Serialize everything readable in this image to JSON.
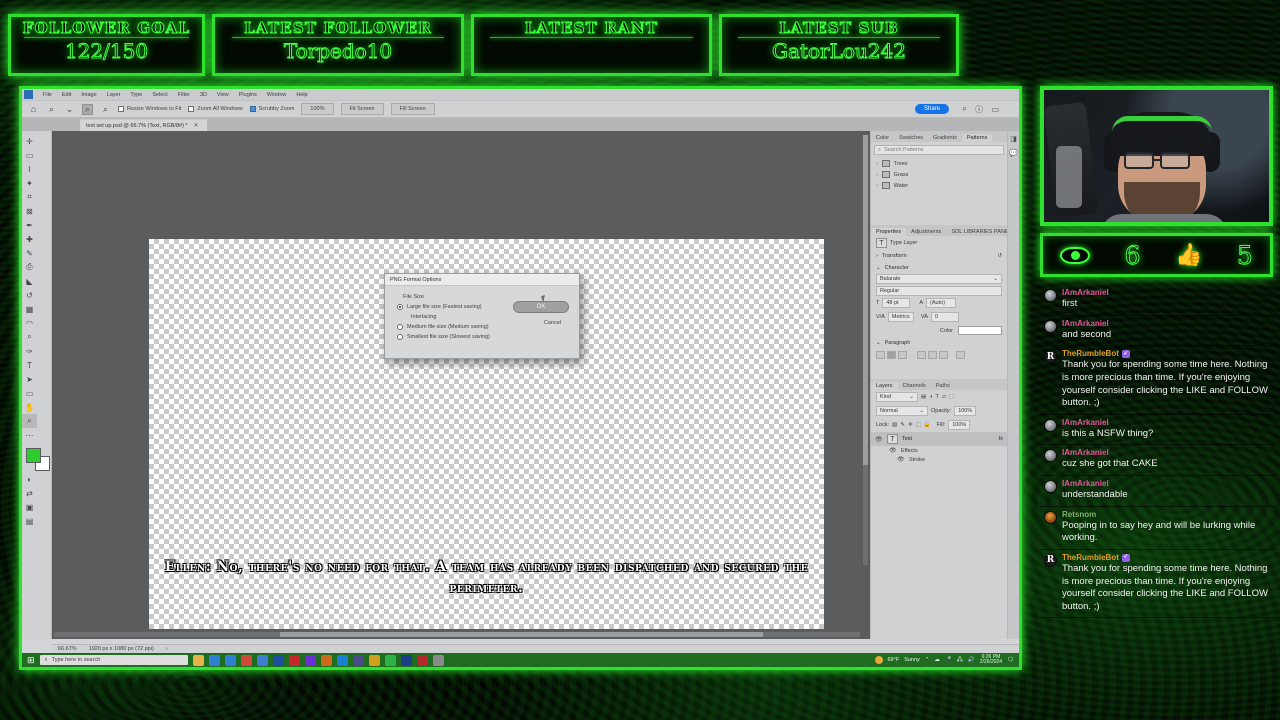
{
  "overlay": {
    "accent_green": "#2fe02f",
    "panels": [
      {
        "title": "FOLLOWER GOAL",
        "value": "122/150"
      },
      {
        "title": "LATEST FOLLOWER",
        "value": "Torpedo10"
      },
      {
        "title": "LATEST RANT",
        "value": ""
      },
      {
        "title": "LATEST SUB",
        "value": "GatorLou242"
      }
    ],
    "stats": {
      "viewers": "6",
      "likes": "5",
      "eye_icon": "eye-icon",
      "like_icon": "thumbs-up-icon"
    }
  },
  "chat": {
    "messages": [
      {
        "user": "IAmArkaniel",
        "color": "#e8559b",
        "avatar": "user",
        "badge": "",
        "text": "first"
      },
      {
        "user": "IAmArkaniel",
        "color": "#e8559b",
        "avatar": "user",
        "badge": "",
        "text": "and second"
      },
      {
        "user": "TheRumbleBot",
        "color": "#e0a02a",
        "avatar": "bot",
        "badge": "shield-badge",
        "text": "Thank you for spending some time here. Nothing is more precious than time. If you're enjoying yourself consider clicking the LIKE and FOLLOW button. ;)"
      },
      {
        "user": "IAmArkaniel",
        "color": "#e8559b",
        "avatar": "user",
        "badge": "",
        "text": "is this a NSFW thing?"
      },
      {
        "user": "IAmArkaniel",
        "color": "#e8559b",
        "avatar": "user",
        "badge": "",
        "text": "cuz she got that CAKE"
      },
      {
        "user": "IAmArkaniel",
        "color": "#e8559b",
        "avatar": "user",
        "badge": "",
        "text": "understandable"
      },
      {
        "user": "Retsnom",
        "color": "#7fb26a",
        "avatar": "rets",
        "badge": "",
        "text": "Pooping in to say hey and will be lurking while working."
      },
      {
        "user": "TheRumbleBot",
        "color": "#e0a02a",
        "avatar": "bot",
        "badge": "shield-badge",
        "text": "Thank you for spending some time here. Nothing is more precious than time. If you're enjoying yourself consider clicking the LIKE and FOLLOW button. ;)"
      }
    ]
  },
  "photoshop": {
    "menus": [
      "File",
      "Edit",
      "Image",
      "Layer",
      "Type",
      "Select",
      "Filter",
      "3D",
      "View",
      "Plugins",
      "Window",
      "Help"
    ],
    "options_bar": {
      "home_icon": "home-icon",
      "zoom_icon": "zoom-tool-icon",
      "checkboxes": [
        {
          "label": "Resize Windows to Fit",
          "checked": false
        },
        {
          "label": "Zoom All Windows",
          "checked": false
        },
        {
          "label": "Scrubby Zoom",
          "checked": true
        }
      ],
      "buttons": [
        "100%",
        "Fit Screen",
        "Fill Screen"
      ],
      "share_label": "Share"
    },
    "document_tab": "text set up.psd @ 66.7% (Text, RGB/8#) *",
    "canvas_subtitle": "Ellen: No, there's no need for that. A team has already been dispatched and secured the perimeter.",
    "dialog": {
      "title": "PNG Format Options",
      "group_label": "File Size",
      "options": [
        {
          "label": "Large file size (Fastest saving)",
          "selected": true
        },
        {
          "label": "Interlacing",
          "selected": false
        },
        {
          "label": "Medium file size (Medium saving)",
          "selected": false
        },
        {
          "label": "Smallest file size (Slowest saving)",
          "selected": false
        }
      ],
      "ok_label": "OK",
      "cancel_label": "Cancel"
    },
    "patterns_panel": {
      "tabs": [
        "Color",
        "Swatches",
        "Gradients",
        "Patterns"
      ],
      "active_tab": "Patterns",
      "search_placeholder": "Search Patterns",
      "groups": [
        "Trees",
        "Grass",
        "Water"
      ]
    },
    "properties_panel": {
      "tabs": [
        "Properties",
        "Adjustments",
        "SOL LIBRARIES PANE"
      ],
      "active_tab": "Properties",
      "layer_type": "Type Layer",
      "transform_label": "Transform",
      "character_label": "Character",
      "font_family": "Balarate",
      "font_style": "Regular",
      "font_size": "48 pt",
      "leading": "(Auto)",
      "kerning": "Metrics",
      "tracking": "0",
      "color_label": "Color",
      "paragraph_label": "Paragraph"
    },
    "layers_panel": {
      "tabs": [
        "Layers",
        "Channels",
        "Paths"
      ],
      "active_tab": "Layers",
      "filter_label": "Kind",
      "blend_mode": "Normal",
      "opacity_label": "Opacity:",
      "opacity_value": "100%",
      "lock_label": "Lock:",
      "fill_label": "Fill:",
      "fill_value": "100%",
      "layer_name": "Text",
      "effects_label": "Effects",
      "effect_stroke": "Stroke"
    },
    "status_bar": {
      "zoom": "66.67%",
      "dimensions": "1920 px x 1080 px (72 ppi)"
    },
    "taskbar": {
      "search_placeholder": "Type here to search",
      "weather_temp": "69°F",
      "weather_cond": "Sunny",
      "time": "6:26 PM",
      "date": "2/26/2024"
    }
  }
}
